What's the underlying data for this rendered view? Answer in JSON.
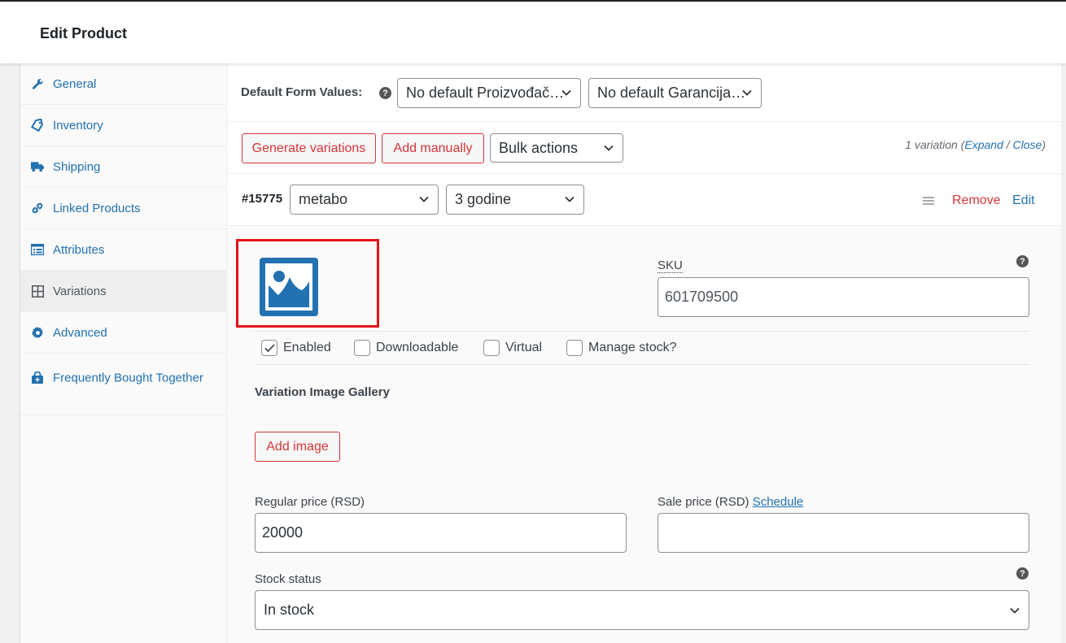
{
  "header": {
    "title": "Edit Product"
  },
  "tabs": [
    {
      "label": "General",
      "icon": "wrench-icon"
    },
    {
      "label": "Inventory",
      "icon": "tag-icon"
    },
    {
      "label": "Shipping",
      "icon": "truck-icon"
    },
    {
      "label": "Linked Products",
      "icon": "link-icon"
    },
    {
      "label": "Attributes",
      "icon": "list-icon"
    },
    {
      "label": "Variations",
      "icon": "grid-icon",
      "active": true
    },
    {
      "label": "Advanced",
      "icon": "gear-icon"
    },
    {
      "label": "Frequently Bought Together",
      "icon": "bag-icon"
    }
  ],
  "defaults": {
    "label": "Default Form Values:",
    "help": "?",
    "select1": "No default Proizvođač…",
    "select2": "No default Garancija…"
  },
  "actions": {
    "generate": "Generate variations",
    "add_manually": "Add manually",
    "bulk": "Bulk actions",
    "count_text": "1 variation (",
    "expand": "Expand",
    "slash": " / ",
    "close": "Close",
    "close_paren": ")"
  },
  "variation": {
    "id": "#15775",
    "attr1": "metabo",
    "attr2": "3 godine",
    "remove": "Remove",
    "edit": "Edit",
    "sku_label": "SKU",
    "sku_value": "601709500",
    "checkboxes": {
      "enabled": "Enabled",
      "downloadable": "Downloadable",
      "virtual": "Virtual",
      "manage_stock": "Manage stock?"
    },
    "gallery_title": "Variation Image Gallery",
    "add_image": "Add image",
    "regular_price_label": "Regular price (RSD)",
    "regular_price_value": "20000",
    "sale_price_label": "Sale price (RSD)",
    "schedule": "Schedule",
    "stock_status_label": "Stock status",
    "stock_status_value": "In stock"
  },
  "colors": {
    "accent": "#2271b1",
    "danger": "#d63638",
    "highlight": "#e5111a"
  }
}
